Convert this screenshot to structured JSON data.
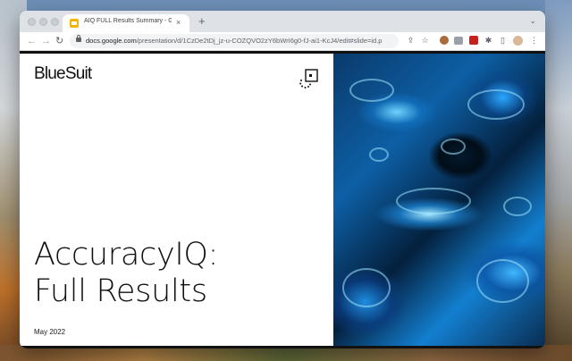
{
  "browser": {
    "tab": {
      "title": "AIQ FULL Results Summary - G",
      "close_glyph": "×",
      "favicon": "google-slides-icon"
    },
    "new_tab_glyph": "+",
    "tab_list_glyph": "⌄",
    "nav": {
      "back": "←",
      "forward": "→",
      "reload": "↻"
    },
    "url": {
      "domain": "docs.google.com",
      "path": "/presentation/d/1CzDe2tDj_jz-u-COZQVO2zY6bWrI6g0-fJ-ai1-KcJ4/edit#slide=id.p"
    },
    "toolbar_icons": [
      "share-icon",
      "star-icon",
      "cookie-extension-icon",
      "camera-extension-icon",
      "notification-extension-icon",
      "puzzle-extensions-icon",
      "sidebar-icon",
      "profile-avatar",
      "menu-dots-icon"
    ],
    "toolbar_glyphs": {
      "share": "⇪",
      "star": "☆",
      "puzzle": "✱",
      "sidebar": "▯",
      "menu": "⋮"
    }
  },
  "slide": {
    "brand": "BlueSuit",
    "title_line1": "AccuracyIQ:",
    "title_line2": "Full Results",
    "date": "May 2022",
    "image": "abstract-blue-fluid-art"
  },
  "colors": {
    "accent": "#f4b400",
    "slide_bg": "#ffffff",
    "text": "#111111"
  }
}
